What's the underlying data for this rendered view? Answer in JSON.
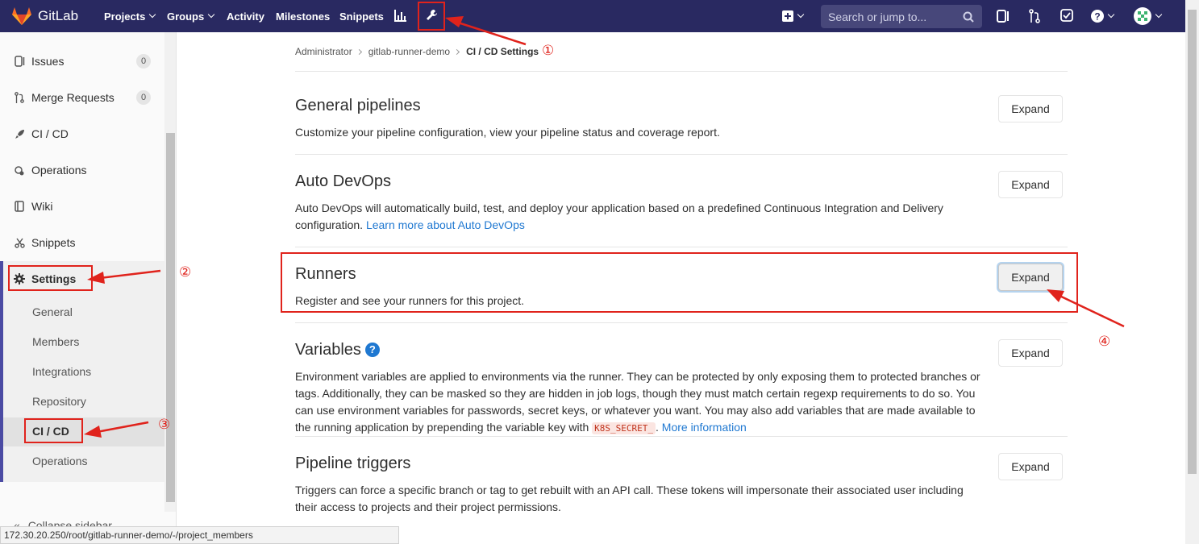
{
  "navbar": {
    "brand": "GitLab",
    "menu": [
      "Projects",
      "Groups",
      "Activity",
      "Milestones",
      "Snippets"
    ],
    "search_placeholder": "Search or jump to..."
  },
  "sidebar": {
    "items": [
      {
        "label": "Issues",
        "count": "0"
      },
      {
        "label": "Merge Requests",
        "count": "0"
      },
      {
        "label": "CI / CD"
      },
      {
        "label": "Operations"
      },
      {
        "label": "Wiki"
      },
      {
        "label": "Snippets"
      },
      {
        "label": "Settings"
      }
    ],
    "settings_sub": [
      "General",
      "Members",
      "Integrations",
      "Repository",
      "CI / CD",
      "Operations"
    ],
    "collapse_label": "Collapse sidebar"
  },
  "status_url": "172.30.20.250/root/gitlab-runner-demo/-/project_members",
  "breadcrumb": [
    "Administrator",
    "gitlab-runner-demo",
    "CI / CD Settings"
  ],
  "sections": [
    {
      "title": "General pipelines",
      "desc": "Customize your pipeline configuration, view your pipeline status and coverage report.",
      "button": "Expand"
    },
    {
      "title": "Auto DevOps",
      "desc": "Auto DevOps will automatically build, test, and deploy your application based on a predefined Continuous Integration and Delivery configuration.",
      "link": "Learn more about Auto DevOps",
      "button": "Expand"
    },
    {
      "title": "Runners",
      "desc": "Register and see your runners for this project.",
      "button": "Expand"
    },
    {
      "title": "Variables",
      "desc": "Environment variables are applied to environments via the runner. They can be protected by only exposing them to protected branches or tags. Additionally, they can be masked so they are hidden in job logs, though they must match certain regexp requirements to do so. You can use environment variables for passwords, secret keys, or whatever you want. You may also add variables that are made available to the running application by prepending the variable key with",
      "code": "K8S_SECRET_",
      "link": "More information",
      "button": "Expand"
    },
    {
      "title": "Pipeline triggers",
      "desc": "Triggers can force a specific branch or tag to get rebuilt with an API call. These tokens will impersonate their associated user including their access to projects and their project permissions.",
      "button": "Expand"
    }
  ],
  "annotations": [
    "①",
    "②",
    "③",
    "④"
  ],
  "colors": {
    "navbar": "#292961",
    "annotation": "#e0231c",
    "link": "#1f78d1"
  }
}
